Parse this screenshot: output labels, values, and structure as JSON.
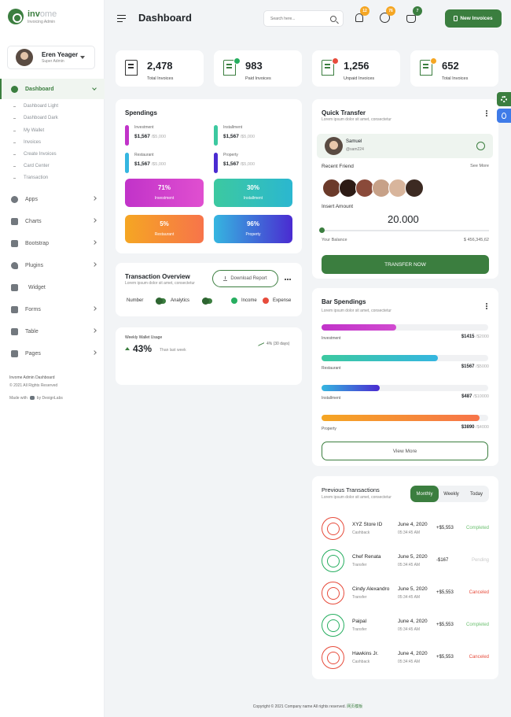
{
  "brand": {
    "name_1": "inv",
    "name_2": "ome",
    "subtitle": "Invoicing Admin"
  },
  "profile": {
    "name": "Eren Yeager",
    "role": "Super Admin"
  },
  "nav": {
    "dashboard": "Dashboard",
    "sub_items": [
      "Dashboard Light",
      "Dashboard Dark",
      "My Wallet",
      "Invoices",
      "Create Invoices",
      "Card Center",
      "Transaction"
    ],
    "items": [
      "Apps",
      "Charts",
      "Bootstrap",
      "Plugins",
      "Widget",
      "Forms",
      "Table",
      "Pages"
    ]
  },
  "sidebar_footer": {
    "line1": "Invome Admin Dashboard",
    "line2": "© 2021 All Rights Reserved",
    "made_prefix": "Made with",
    "made_suffix": "by DexignLabs"
  },
  "header": {
    "title": "Dashboard",
    "search_placeholder": "Search here...",
    "new_button": "New Invoices",
    "badges": [
      "12",
      "76",
      "7"
    ],
    "badge_colors": [
      "#f5a623",
      "#f5a623",
      "#3b7e3f"
    ]
  },
  "stats": [
    {
      "value": "2,478",
      "label": "Total Invoices",
      "dot": ""
    },
    {
      "value": "983",
      "label": "Paid Invoices",
      "dot": "#27ae60"
    },
    {
      "value": "1,256",
      "label": "Unpaid Invoices",
      "dot": "#e74c3c"
    },
    {
      "value": "652",
      "label": "Total Invoices",
      "dot": "#f5a623"
    }
  ],
  "spendings": {
    "title": "Spendings",
    "items": [
      {
        "name": "Investment",
        "value": "$1,567",
        "total": "/$5,000",
        "color": "#c133c9"
      },
      {
        "name": "Installment",
        "value": "$1,567",
        "total": "/$5,000",
        "color": "#3cc9a0"
      },
      {
        "name": "Restaurant",
        "value": "$1,567",
        "total": "/$5,000",
        "color": "#35b6e0"
      },
      {
        "name": "Property",
        "value": "$1,567",
        "total": "/$5,000",
        "color": "#4a2bd1"
      }
    ],
    "tiles": [
      {
        "pct": "71%",
        "label": "Investment"
      },
      {
        "pct": "30%",
        "label": "Installment"
      },
      {
        "pct": "5%",
        "label": "Restaurant"
      },
      {
        "pct": "96%",
        "label": "Property"
      }
    ]
  },
  "overview": {
    "title": "Transaction Overview",
    "subtitle": "Lorem ipsum dolor sit amet, consectetur",
    "download": "Download Report",
    "number": "Number",
    "analytics": "Analytics",
    "income": "Income",
    "expense": "Expense"
  },
  "wallet": {
    "title": "Weekly Wallet Usage",
    "pct": "43%",
    "note": "Than last week",
    "change": "4% (30 days)"
  },
  "quick": {
    "title": "Quick Transfer",
    "subtitle": "Lorem ipsum dolor sit amet, consectetur",
    "user": "Samuel",
    "handle": "@sam224",
    "recent": "Recent Friend",
    "see_more": "See More",
    "insert": "Insert Amount",
    "amount": "20.000",
    "balance_label": "Your Balance",
    "balance": "$ 456,345,62",
    "button": "TRANSFER NOW",
    "friend_colors": [
      "#6b3a2a",
      "#2d1b15",
      "#8a4a3a",
      "#c7a188",
      "#d8b59c",
      "#3c2a22"
    ],
    "slider_value": 0
  },
  "bars": {
    "title": "Bar Spendings",
    "subtitle": "Lorem ipsum dolor sit amet, consectetur",
    "items": [
      {
        "name": "Investment",
        "value": "$1415",
        "total": "/$2000",
        "fraction": 0.45
      },
      {
        "name": "Restaurant",
        "value": "$1567",
        "total": "/$5000",
        "fraction": 0.7
      },
      {
        "name": "Installment",
        "value": "$487",
        "total": "/$10000",
        "fraction": 0.35
      },
      {
        "name": "Property",
        "value": "$3890",
        "total": "/$4000",
        "fraction": 0.95
      }
    ],
    "view_more": "View More"
  },
  "previous": {
    "title": "Previous Transactions",
    "subtitle": "Lorem ipsum dolor sit amet, consectetur",
    "tabs": [
      "Monthly",
      "Weekly",
      "Today"
    ],
    "rows": [
      {
        "name": "XYZ Store ID",
        "cat": "Cashback",
        "date": "June 4, 2020",
        "time": "05:34:45 AM",
        "amount": "+$5,553",
        "status": "Completed",
        "dir": "up"
      },
      {
        "name": "Chef Renata",
        "cat": "Transfer",
        "date": "June 5, 2020",
        "time": "05:34:45 AM",
        "amount": "-$167",
        "status": "Pending",
        "dir": "down"
      },
      {
        "name": "Cindy Alexandro",
        "cat": "Transfer",
        "date": "June 5, 2020",
        "time": "05:34:45 AM",
        "amount": "+$5,553",
        "status": "Canceled",
        "dir": "up"
      },
      {
        "name": "Paipal",
        "cat": "Transfer",
        "date": "June 4, 2020",
        "time": "05:34:45 AM",
        "amount": "+$5,553",
        "status": "Completed",
        "dir": "down"
      },
      {
        "name": "Hawkins Jr.",
        "cat": "Cashback",
        "date": "June 4, 2020",
        "time": "05:34:45 AM",
        "amount": "+$5,553",
        "status": "Canceled",
        "dir": "up"
      }
    ]
  },
  "footer": {
    "text": "Copyright © 2021 Company name All rights reserved.",
    "link": "网页模板"
  },
  "colors": {
    "primary": "#3b7e3f",
    "success": "#27ae60",
    "danger": "#e74c3c",
    "completed": "#6cc070",
    "pending": "#c9c9c9",
    "canceled": "#e74c3c"
  }
}
